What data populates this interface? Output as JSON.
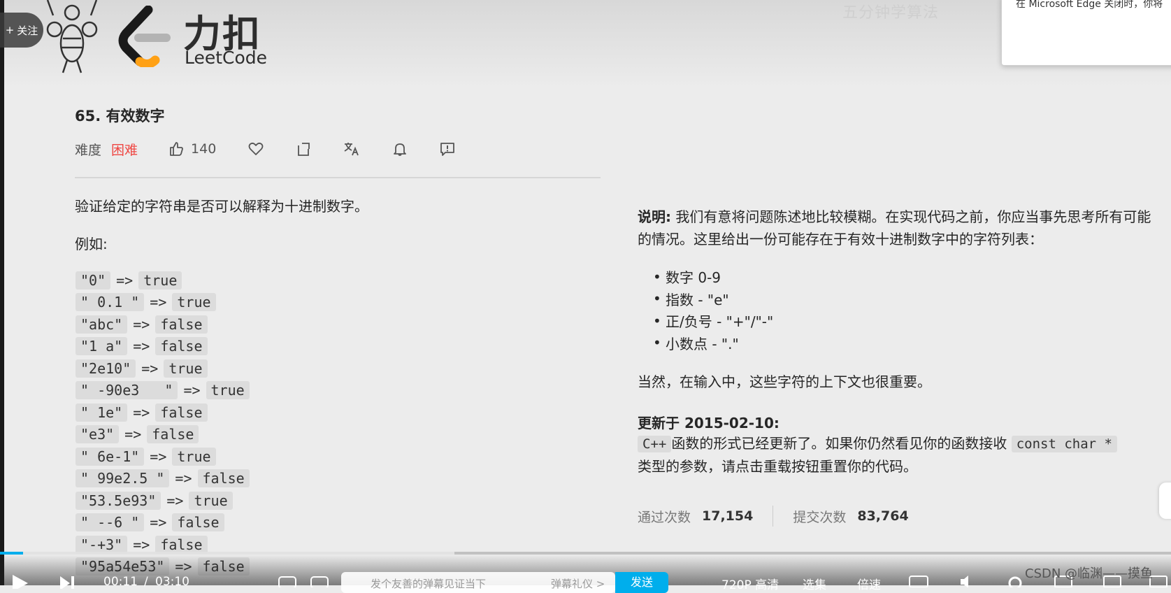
{
  "player": {
    "follow_label": "关注",
    "current_time": "00:11",
    "time_sep": "/",
    "duration": "03:10",
    "danmaku_placeholder": "发个友善的弹幕见证当下",
    "danmaku_etiquette": "弹幕礼仪 >",
    "send_label": "发送",
    "quality": "720P 高清",
    "episodes": "选集",
    "speed": "倍速",
    "accent": "#00aeec"
  },
  "overlay": {
    "edge_notice": "在 Microsoft Edge 关闭时，你将",
    "top_watermark": "五分钟学算法"
  },
  "logo": {
    "zh": "力扣",
    "en": "LeetCode"
  },
  "problem": {
    "title": "65. 有效数字",
    "difficulty_label": "难度",
    "difficulty": "困难",
    "likes": "140",
    "difficulty_color": "#ef4743",
    "toolbar_icons": [
      "thumbs-up-icon",
      "heart-icon",
      "share-icon",
      "translate-icon",
      "bell-icon",
      "feedback-icon"
    ]
  },
  "description": {
    "intro": "验证给定的字符串是否可以解释为十进制数字。",
    "example_label": "例如:",
    "arrow": "=>",
    "examples": [
      {
        "input": "\"0\"",
        "output": "true"
      },
      {
        "input": "\" 0.1 \"",
        "output": "true"
      },
      {
        "input": "\"abc\"",
        "output": "false"
      },
      {
        "input": "\"1 a\"",
        "output": "false"
      },
      {
        "input": "\"2e10\"",
        "output": "true"
      },
      {
        "input": "\" -90e3   \"",
        "output": "true"
      },
      {
        "input": "\" 1e\"",
        "output": "false"
      },
      {
        "input": "\"e3\"",
        "output": "false"
      },
      {
        "input": "\" 6e-1\"",
        "output": "true"
      },
      {
        "input": "\" 99e2.5 \"",
        "output": "false"
      },
      {
        "input": "\"53.5e93\"",
        "output": "true"
      },
      {
        "input": "\" --6 \"",
        "output": "false"
      },
      {
        "input": "\"-+3\"",
        "output": "false"
      },
      {
        "input": "\"95a54e53\"",
        "output": "false"
      }
    ]
  },
  "notes": {
    "note_label": "说明:",
    "note_text": "我们有意将问题陈述地比较模糊。在实现代码之前，你应当事先思考所有可能的情况。这里给出一份可能存在于有效十进制数字中的字符列表：",
    "bullets": [
      "数字 0-9",
      "指数 - \"e\"",
      "正/负号 - \"+\"/\"-\"",
      "小数点 - \".\""
    ],
    "context": "当然，在输入中，这些字符的上下文也很重要。",
    "update_heading": "更新于 2015-02-10:",
    "update_code1": "C++",
    "update_text1": "函数的形式已经更新了。如果你仍然看见你的函数接收",
    "update_code2": "const char *",
    "update_text2": "类型的参数，请点击重载按钮重置你的代码。"
  },
  "stats": {
    "accepted_label": "通过次数",
    "accepted": "17,154",
    "submitted_label": "提交次数",
    "submitted": "83,764"
  },
  "footer": {
    "csdn_watermark": "CSDN @临渊——摸鱼"
  }
}
